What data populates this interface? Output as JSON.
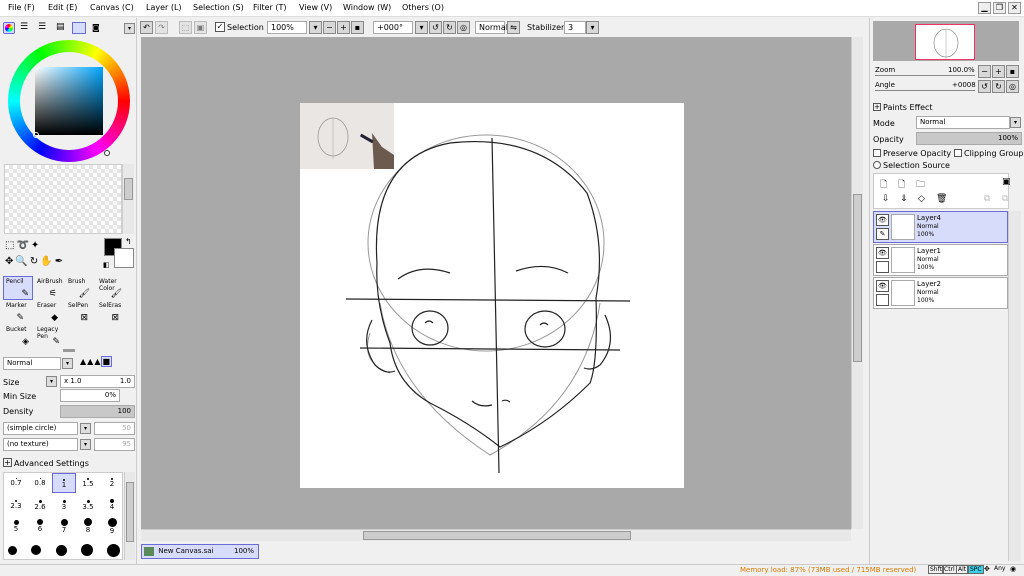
{
  "menu": [
    "File (F)",
    "Edit (E)",
    "Canvas (C)",
    "Layer (L)",
    "Selection (S)",
    "Filter (T)",
    "View (V)",
    "Window (W)",
    "Others (O)"
  ],
  "toolbar": {
    "selection_label": "Selection",
    "zoom": "100%",
    "angle": "+000°",
    "mode": "Normal",
    "stabilizer_label": "Stabilizer",
    "stabilizer_value": "3"
  },
  "tools": [
    {
      "label": "Pencil",
      "selected": true
    },
    {
      "label": "AirBrush",
      "selected": false
    },
    {
      "label": "Brush",
      "selected": false
    },
    {
      "label": "Water Color",
      "selected": false
    },
    {
      "label": "Marker",
      "selected": false
    },
    {
      "label": "Eraser",
      "selected": false
    },
    {
      "label": "SelPen",
      "selected": false
    },
    {
      "label": "SelEras",
      "selected": false
    },
    {
      "label": "Bucket",
      "selected": false
    },
    {
      "label": "Legacy Pen",
      "selected": false
    }
  ],
  "brush": {
    "blend_mode": "Normal",
    "size_label": "Size",
    "size_multiplier": "x 1.0",
    "size_value": "1.0",
    "min_size_label": "Min Size",
    "min_size_value": "0%",
    "density_label": "Density",
    "density_value": "100",
    "shape": "(simple circle)",
    "shape_value": "50",
    "texture": "(no texture)",
    "texture_value": "95",
    "advanced_label": "Advanced Settings"
  },
  "brush_sizes": [
    "0.7",
    "0.8",
    "1",
    "1.5",
    "2",
    "2.3",
    "2.6",
    "3",
    "3.5",
    "4",
    "5",
    "6",
    "7",
    "8",
    "9"
  ],
  "navigator": {
    "zoom_label": "Zoom",
    "zoom_value": "100.0%",
    "angle_label": "Angle",
    "angle_value": "+0008"
  },
  "layer_props": {
    "paints_effect": "Paints Effect",
    "mode_label": "Mode",
    "mode_value": "Normal",
    "opacity_label": "Opacity",
    "opacity_value": "100%",
    "preserve_opacity": "Preserve Opacity",
    "clipping_group": "Clipping Group",
    "selection_source": "Selection Source"
  },
  "layers": [
    {
      "name": "Layer4",
      "mode": "Normal",
      "opacity": "100%",
      "selected": true
    },
    {
      "name": "Layer1",
      "mode": "Normal",
      "opacity": "100%",
      "selected": false
    },
    {
      "name": "Layer2",
      "mode": "Normal",
      "opacity": "100%",
      "selected": false
    }
  ],
  "document_tab": {
    "name": "New Canvas.sai",
    "zoom": "100%"
  },
  "status": {
    "memory": "Memory load: 87% (73MB used / 715MB reserved)",
    "keys": [
      "Shft",
      "Ctrl",
      "Alt",
      "SPC",
      "Any"
    ]
  },
  "colors": {
    "accent": "#6b6bd8",
    "selection_bg": "#d8dcfb",
    "canvas_bg": "#a9a9a9",
    "status_text": "#e07a00"
  }
}
